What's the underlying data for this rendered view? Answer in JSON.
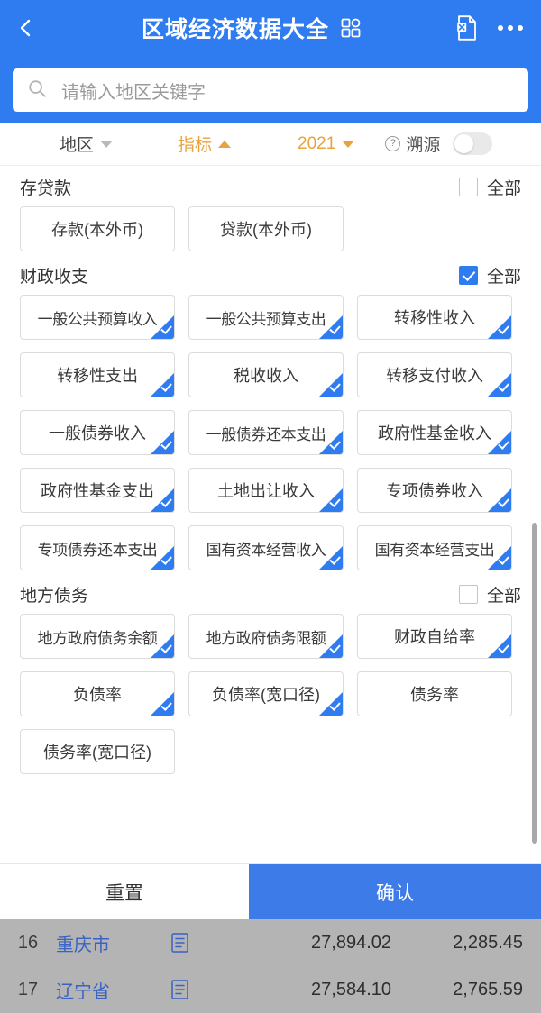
{
  "header": {
    "back_icon": "chevron-left-icon",
    "title": "区域经济数据大全",
    "grid_icon": "grid-apps-icon",
    "excel_icon": "excel-file-icon",
    "more_icon": "more-dots-icon",
    "accent": "#2f7bf0"
  },
  "search": {
    "icon": "search-icon",
    "placeholder": "请输入地区关键字",
    "value": ""
  },
  "filterbar": {
    "region": "地区",
    "indicator": "指标",
    "year": "2021",
    "trace_label": "溯源",
    "trace_help_icon": "question-mark-icon",
    "trace_on": false,
    "accent_orange": "#e8a33d"
  },
  "sections": [
    {
      "title": "存贷款",
      "all_label": "全部",
      "all_checked": false,
      "chips": [
        {
          "label": "存款(本外币)",
          "selected": false
        },
        {
          "label": "贷款(本外币)",
          "selected": false
        }
      ]
    },
    {
      "title": "财政收支",
      "all_label": "全部",
      "all_checked": true,
      "chips": [
        {
          "label": "一般公共预算收入",
          "selected": true,
          "tight": true
        },
        {
          "label": "一般公共预算支出",
          "selected": true,
          "tight": true
        },
        {
          "label": "转移性收入",
          "selected": true
        },
        {
          "label": "转移性支出",
          "selected": true
        },
        {
          "label": "税收收入",
          "selected": true
        },
        {
          "label": "转移支付收入",
          "selected": true
        },
        {
          "label": "一般债券收入",
          "selected": true
        },
        {
          "label": "一般债券还本支出",
          "selected": true,
          "tight": true
        },
        {
          "label": "政府性基金收入",
          "selected": true
        },
        {
          "label": "政府性基金支出",
          "selected": true
        },
        {
          "label": "土地出让收入",
          "selected": true
        },
        {
          "label": "专项债券收入",
          "selected": true
        },
        {
          "label": "专项债券还本支出",
          "selected": true,
          "tight": true
        },
        {
          "label": "国有资本经营收入",
          "selected": true,
          "tight": true
        },
        {
          "label": "国有资本经营支出",
          "selected": true,
          "tight": true
        }
      ]
    },
    {
      "title": "地方债务",
      "all_label": "全部",
      "all_checked": false,
      "chips": [
        {
          "label": "地方政府债务余额",
          "selected": true,
          "tight": true
        },
        {
          "label": "地方政府债务限额",
          "selected": true,
          "tight": true
        },
        {
          "label": "财政自给率",
          "selected": true
        },
        {
          "label": "负债率",
          "selected": true
        },
        {
          "label": "负债率(宽口径)",
          "selected": true
        },
        {
          "label": "债务率",
          "selected": false
        },
        {
          "label": "债务率(宽口径)",
          "selected": false
        }
      ]
    }
  ],
  "footer": {
    "reset_label": "重置",
    "confirm_label": "确认",
    "confirm_color": "#3d7be8"
  },
  "table": {
    "rows": [
      {
        "index": "16",
        "name": "重庆市",
        "doc_icon": "document-icon",
        "value1": "27,894.02",
        "value2": "2,285.45"
      },
      {
        "index": "17",
        "name": "辽宁省",
        "doc_icon": "document-icon",
        "value1": "27,584.10",
        "value2": "2,765.59"
      }
    ]
  }
}
